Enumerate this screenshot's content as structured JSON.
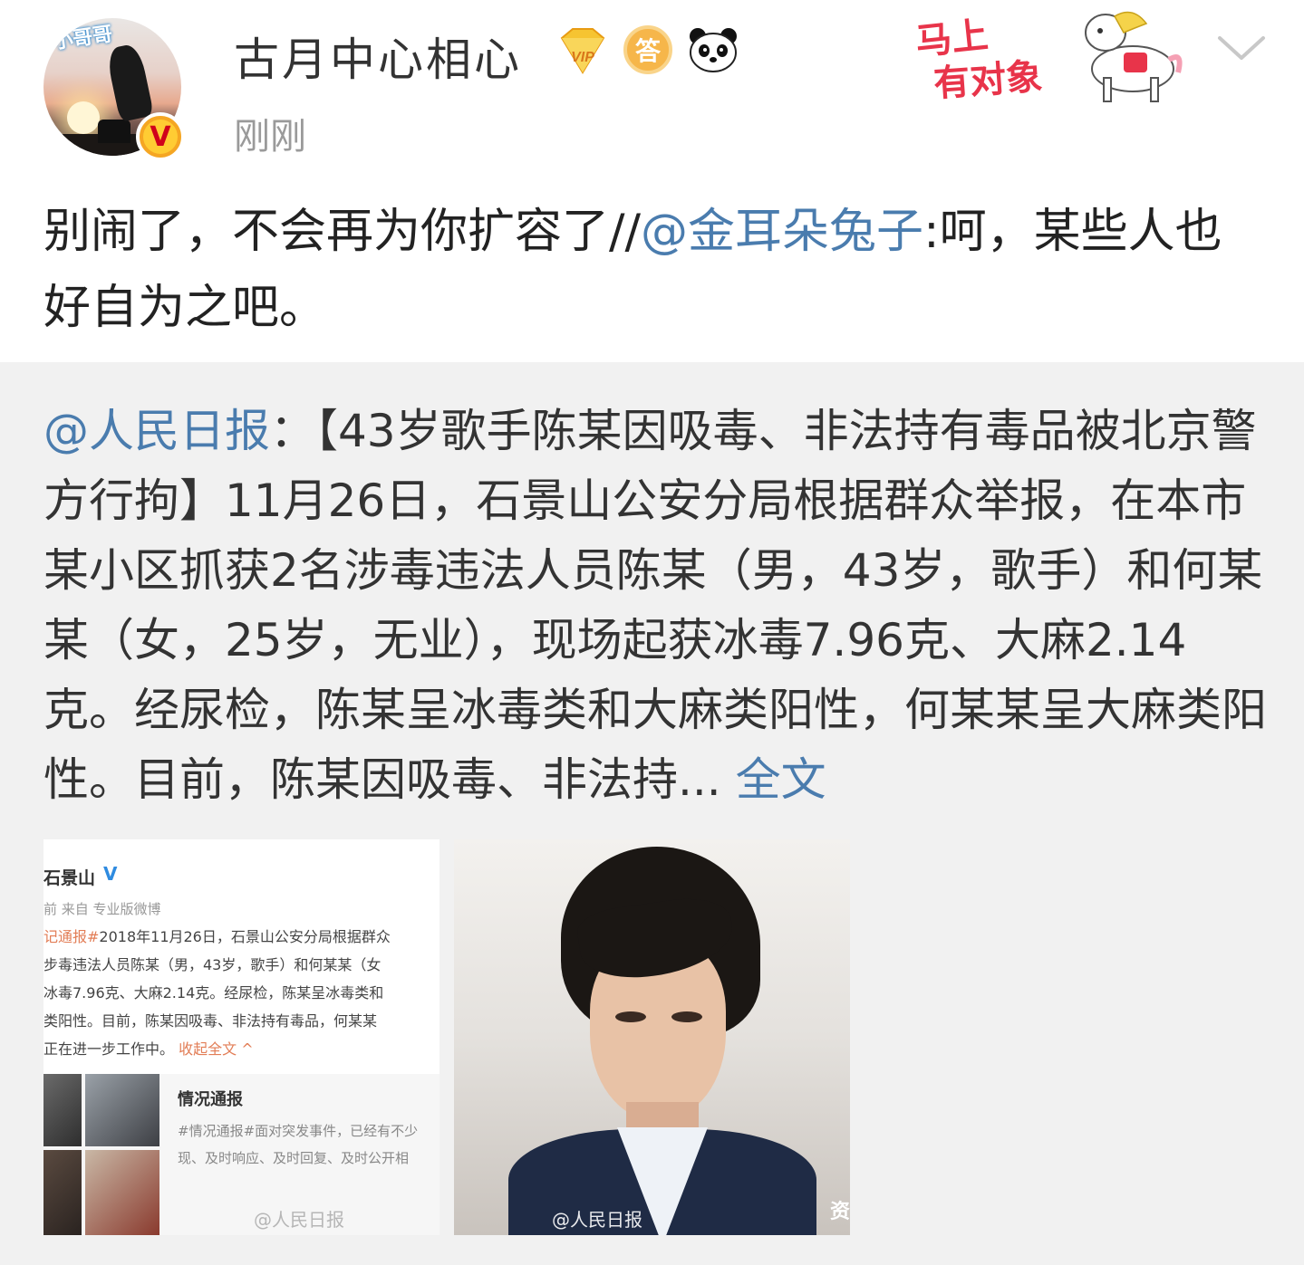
{
  "header": {
    "username": "古月中心相心",
    "timestamp": "刚刚",
    "avatar_tag": "小哥哥",
    "verified_badge": "V",
    "answer_badge": "答",
    "vip_badge": "VIP",
    "sticker_line1": "马上",
    "sticker_line2": "有对象"
  },
  "post": {
    "text_before": "别闹了，不会再为你扩容了//",
    "mention": "@金耳朵兔子",
    "text_after": ":呵，某些人也好自为之吧。"
  },
  "repost": {
    "mention": "@人民日报",
    "body": "：【43岁歌手陈某因吸毒、非法持有毒品被北京警方行拘】11月26日，石景山公安分局根据群众举报，在本市某小区抓获2名涉毒违法人员陈某（男，43岁，歌手）和何某某（女，25岁，无业），现场起获冰毒7.96克、大麻2.14克。经尿检，陈某呈冰毒类和大麻类阳性，何某某呈大麻类阳性。目前，陈某因吸毒、非法持...",
    "fulltext_link": "全文"
  },
  "thumb1": {
    "account": "石景山",
    "verified": "V",
    "source": "前 来自 专业版微博",
    "line1_hl": "记通报#",
    "line1": "2018年11月26日，石景山公安分局根据群众",
    "line2": "步毒违法人员陈某（男，43岁，歌手）和何某某（女",
    "line3": "冰毒7.96克、大麻2.14克。经尿检，陈某呈冰毒类和",
    "line4": "类阳性。目前，陈某因吸毒、非法持有毒品，何某某",
    "line5": "正在进一步工作中。",
    "collapse": "收起全文 ^",
    "card_title": "情况通报",
    "card_desc1": "#情况通报#面对突发事件，已经有不少",
    "card_desc2": "现、及时响应、及时回复、及时公开相",
    "watermark": "@人民日报"
  },
  "thumb2": {
    "watermark": "@人民日报",
    "corner_text": "资"
  },
  "icons": {
    "chevron": "chevron-down-icon",
    "vip": "vip-diamond-icon",
    "panda": "panda-icon"
  },
  "colors": {
    "link": "#4a7cae",
    "username": "#333333",
    "timestamp": "#9a9a9a",
    "repost_bg": "#f1f1f1",
    "highlight": "#e27d56"
  }
}
